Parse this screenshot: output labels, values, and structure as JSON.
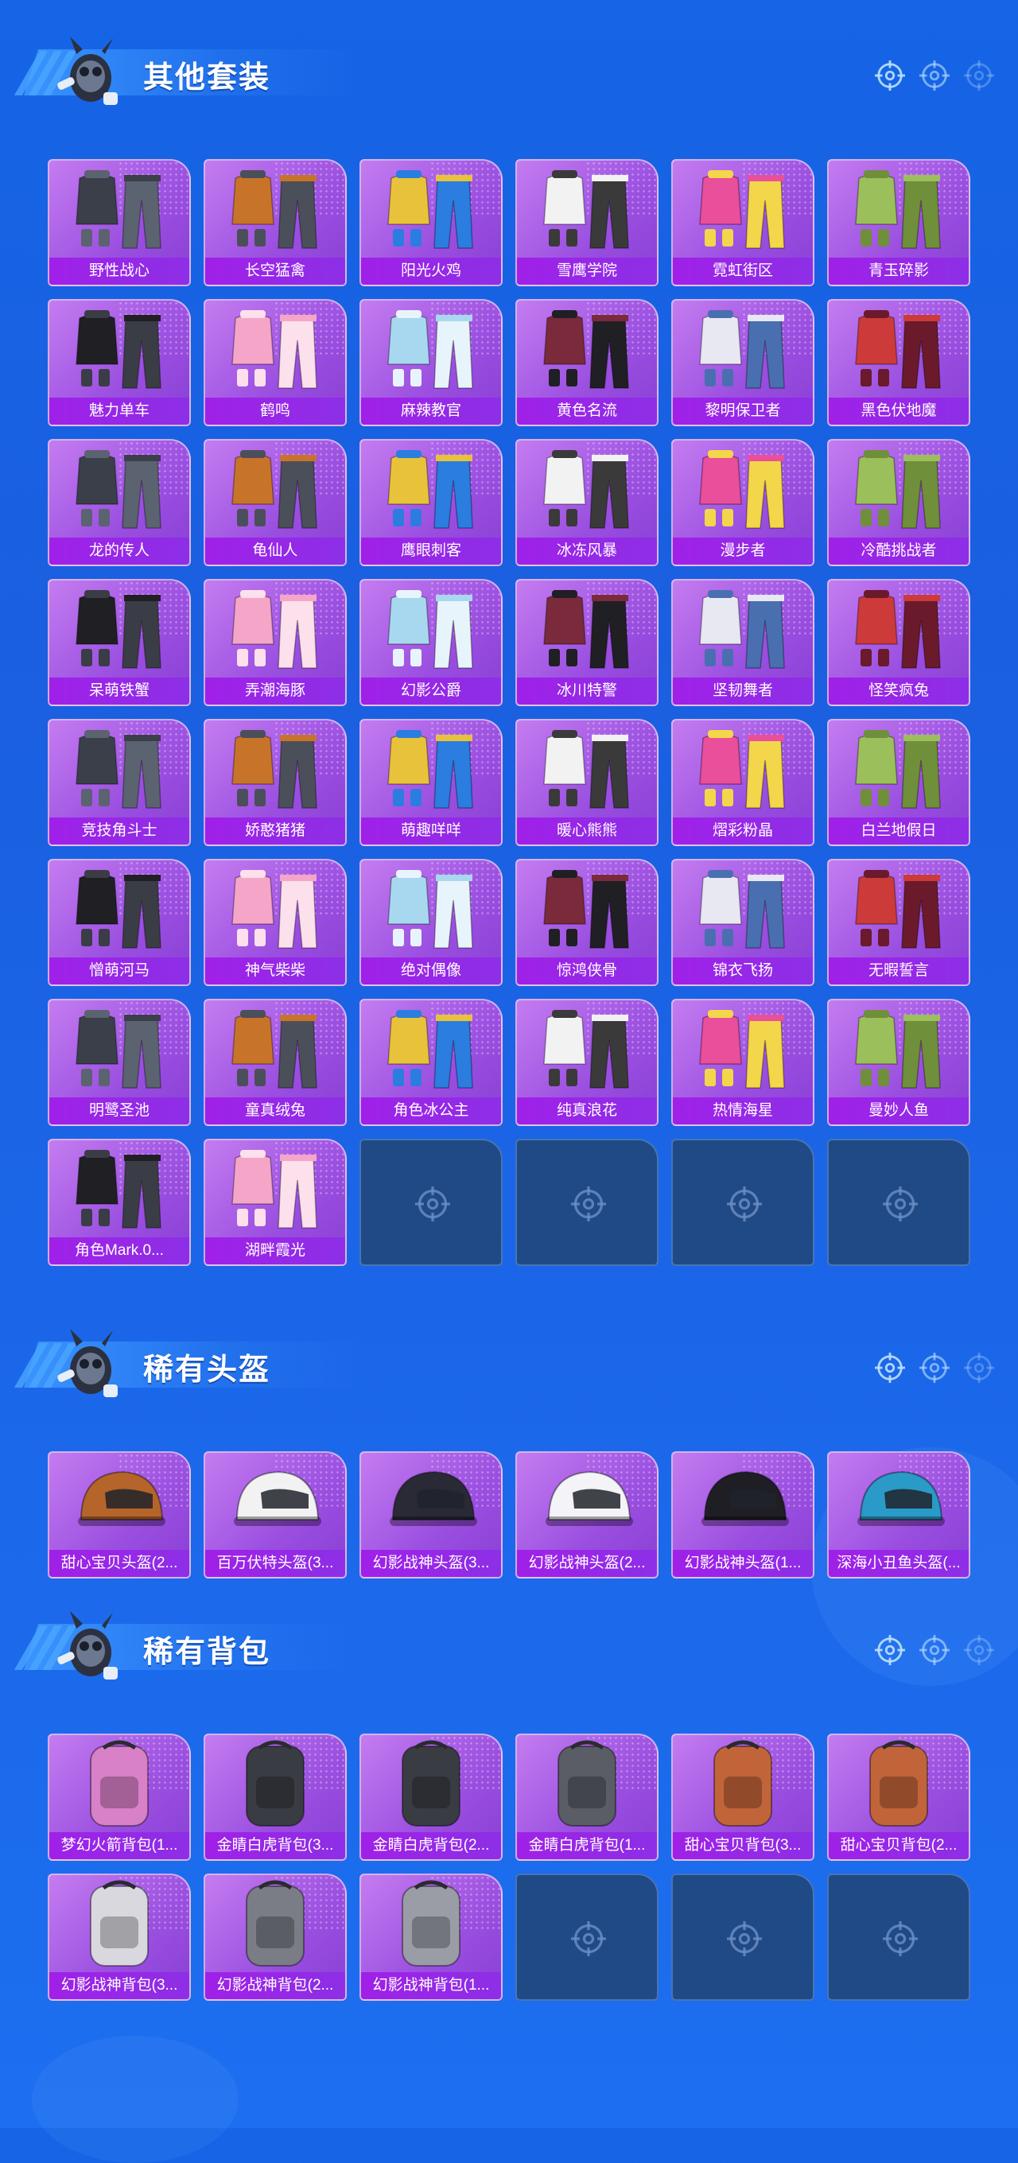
{
  "colors": {
    "background": "#1a5fe0",
    "card_purple": "#9a4fe0",
    "label_purple": "#a020e8",
    "empty_card": "#1f4a86"
  },
  "sections": [
    {
      "title": "其他套装",
      "items": [
        {
          "label": "野性战心",
          "icon": "outfit-icon"
        },
        {
          "label": "长空猛禽",
          "icon": "outfit-icon"
        },
        {
          "label": "阳光火鸡",
          "icon": "outfit-icon"
        },
        {
          "label": "雪鹰学院",
          "icon": "outfit-icon"
        },
        {
          "label": "霓虹街区",
          "icon": "outfit-icon"
        },
        {
          "label": "青玉碎影",
          "icon": "outfit-icon"
        },
        {
          "label": "魅力单车",
          "icon": "outfit-icon"
        },
        {
          "label": "鹤鸣",
          "icon": "outfit-icon"
        },
        {
          "label": "麻辣教官",
          "icon": "outfit-icon"
        },
        {
          "label": "黄色名流",
          "icon": "outfit-icon"
        },
        {
          "label": "黎明保卫者",
          "icon": "outfit-icon"
        },
        {
          "label": "黑色伏地魔",
          "icon": "outfit-icon"
        },
        {
          "label": "龙的传人",
          "icon": "outfit-icon"
        },
        {
          "label": "龟仙人",
          "icon": "outfit-icon"
        },
        {
          "label": "鹰眼刺客",
          "icon": "outfit-icon"
        },
        {
          "label": "冰冻风暴",
          "icon": "outfit-icon"
        },
        {
          "label": "漫步者",
          "icon": "outfit-icon"
        },
        {
          "label": "冷酷挑战者",
          "icon": "outfit-icon"
        },
        {
          "label": "呆萌铁蟹",
          "icon": "outfit-icon"
        },
        {
          "label": "弄潮海豚",
          "icon": "outfit-icon"
        },
        {
          "label": "幻影公爵",
          "icon": "outfit-icon"
        },
        {
          "label": "冰川特警",
          "icon": "outfit-icon"
        },
        {
          "label": "坚韧舞者",
          "icon": "outfit-icon"
        },
        {
          "label": "怪笑疯兔",
          "icon": "outfit-icon"
        },
        {
          "label": "竞技角斗士",
          "icon": "outfit-icon"
        },
        {
          "label": "娇憨猪猪",
          "icon": "outfit-icon"
        },
        {
          "label": "萌趣咩咩",
          "icon": "outfit-icon"
        },
        {
          "label": "暖心熊熊",
          "icon": "outfit-icon"
        },
        {
          "label": "熠彩粉晶",
          "icon": "outfit-icon"
        },
        {
          "label": "白兰地假日",
          "icon": "outfit-icon"
        },
        {
          "label": "憎萌河马",
          "icon": "outfit-icon"
        },
        {
          "label": "神气柴柴",
          "icon": "outfit-icon"
        },
        {
          "label": "绝对偶像",
          "icon": "outfit-icon"
        },
        {
          "label": "惊鸿侠骨",
          "icon": "outfit-icon"
        },
        {
          "label": "锦衣飞扬",
          "icon": "outfit-icon"
        },
        {
          "label": "无暇誓言",
          "icon": "outfit-icon"
        },
        {
          "label": "明鹭圣池",
          "icon": "outfit-icon"
        },
        {
          "label": "童真绒兔",
          "icon": "outfit-icon"
        },
        {
          "label": "角色冰公主",
          "icon": "outfit-icon"
        },
        {
          "label": "纯真浪花",
          "icon": "outfit-icon"
        },
        {
          "label": "热情海星",
          "icon": "outfit-icon"
        },
        {
          "label": "曼妙人鱼",
          "icon": "outfit-icon"
        },
        {
          "label": "角色Mark.0...",
          "icon": "outfit-icon"
        },
        {
          "label": "湖畔霞光",
          "icon": "outfit-icon"
        }
      ],
      "empty_slots": 4
    },
    {
      "title": "稀有头盔",
      "items": [
        {
          "label": "甜心宝贝头盔(2...",
          "icon": "helmet-icon"
        },
        {
          "label": "百万伏特头盔(3...",
          "icon": "helmet-icon"
        },
        {
          "label": "幻影战神头盔(3...",
          "icon": "helmet-icon"
        },
        {
          "label": "幻影战神头盔(2...",
          "icon": "helmet-icon"
        },
        {
          "label": "幻影战神头盔(1...",
          "icon": "helmet-icon"
        },
        {
          "label": "深海小丑鱼头盔(...",
          "icon": "helmet-icon"
        }
      ],
      "empty_slots": 0
    },
    {
      "title": "稀有背包",
      "items": [
        {
          "label": "梦幻火箭背包(1...",
          "icon": "backpack-icon"
        },
        {
          "label": "金睛白虎背包(3...",
          "icon": "backpack-icon"
        },
        {
          "label": "金睛白虎背包(2...",
          "icon": "backpack-icon"
        },
        {
          "label": "金睛白虎背包(1...",
          "icon": "backpack-icon"
        },
        {
          "label": "甜心宝贝背包(3...",
          "icon": "backpack-icon"
        },
        {
          "label": "甜心宝贝背包(2...",
          "icon": "backpack-icon"
        },
        {
          "label": "幻影战神背包(3...",
          "icon": "backpack-icon"
        },
        {
          "label": "幻影战神背包(2...",
          "icon": "backpack-icon"
        },
        {
          "label": "幻影战神背包(1...",
          "icon": "backpack-icon"
        }
      ],
      "empty_slots": 3
    }
  ]
}
